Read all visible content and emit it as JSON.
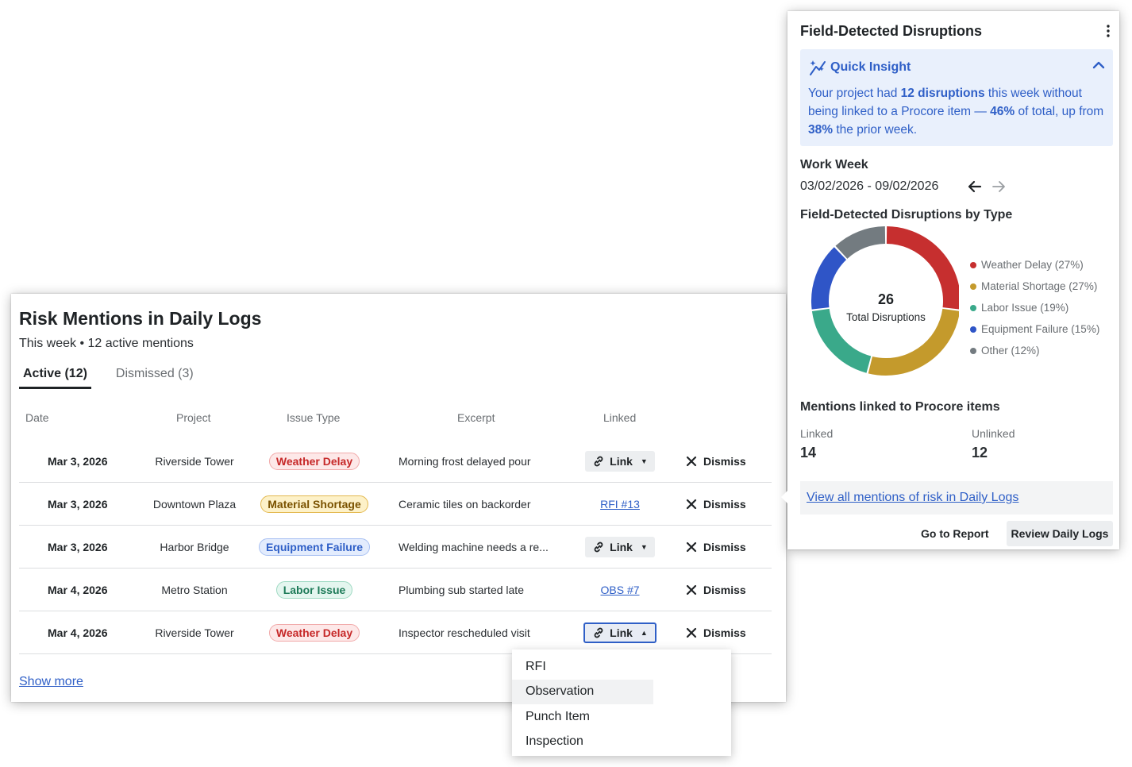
{
  "risk": {
    "title": "Risk Mentions in Daily Logs",
    "subtitle": "This week • 12 active mentions",
    "tabs": [
      {
        "label": "Active (12)"
      },
      {
        "label": "Dismissed (3)"
      }
    ],
    "columns": [
      "Date",
      "Project",
      "Issue Type",
      "Excerpt",
      "Linked"
    ],
    "rows": [
      {
        "date": "Mar 3, 2026",
        "project": "Riverside Tower",
        "issue": "Weather Delay",
        "excerpt": "Morning frost delayed pour",
        "linked": "Link",
        "dismiss": "Dismiss"
      },
      {
        "date": "Mar 3, 2026",
        "project": "Downtown Plaza",
        "issue": "Material Shortage",
        "excerpt": "Ceramic tiles on backorder",
        "linked": "RFI #13",
        "dismiss": "Dismiss"
      },
      {
        "date": "Mar 3, 2026",
        "project": "Harbor Bridge",
        "issue": "Equipment Failure",
        "excerpt": "Welding machine needs a re...",
        "linked": "Link",
        "dismiss": "Dismiss"
      },
      {
        "date": "Mar 4, 2026",
        "project": "Metro Station",
        "issue": "Labor Issue",
        "excerpt": "Plumbing sub started late",
        "linked": "OBS #7",
        "dismiss": "Dismiss"
      },
      {
        "date": "Mar 4, 2026",
        "project": "Riverside Tower",
        "issue": "Weather Delay",
        "excerpt": "Inspector rescheduled visit",
        "linked": "Link",
        "dismiss": "Dismiss"
      }
    ],
    "show_more": "Show more"
  },
  "link_menu": {
    "items": [
      "RFI",
      "Observation",
      "Punch Item",
      "Inspection"
    ],
    "highlighted": "Observation"
  },
  "panel": {
    "title": "Field-Detected Disruptions",
    "insight": {
      "heading": "Quick Insight",
      "text_1": "Your project had ",
      "bold_1": "12 disruptions",
      "text_2": " this week without being linked to a Procore item — ",
      "bold_2": "46%",
      "text_3": " of total, up from ",
      "bold_3": "38%",
      "text_4": " the prior week."
    },
    "work_week_label": "Work Week",
    "work_week_range": "03/02/2026 - 09/02/2026",
    "chart_title": "Field-Detected Disruptions by Type",
    "mentions_title": "Mentions linked to Procore items",
    "linked_label": "Linked",
    "linked_value": "14",
    "unlinked_label": "Unlinked",
    "unlinked_value": "12",
    "view_all": "View all mentions of risk in Daily Logs",
    "go_to_report": "Go to Report",
    "review_logs": "Review Daily Logs"
  },
  "chart_data": {
    "type": "pie",
    "center_value": "26",
    "center_label": "Total Disruptions",
    "slices": [
      {
        "label": "Weather Delay (27%)",
        "value": 27,
        "color": "#c62f2f"
      },
      {
        "label": "Material Shortage (27%)",
        "value": 27,
        "color": "#c49a2c"
      },
      {
        "label": "Labor Issue (19%)",
        "value": 19,
        "color": "#3aa98a"
      },
      {
        "label": "Equipment Failure (15%)",
        "value": 15,
        "color": "#2f55c7"
      },
      {
        "label": "Other (12%)",
        "value": 12,
        "color": "#737b80"
      }
    ]
  }
}
